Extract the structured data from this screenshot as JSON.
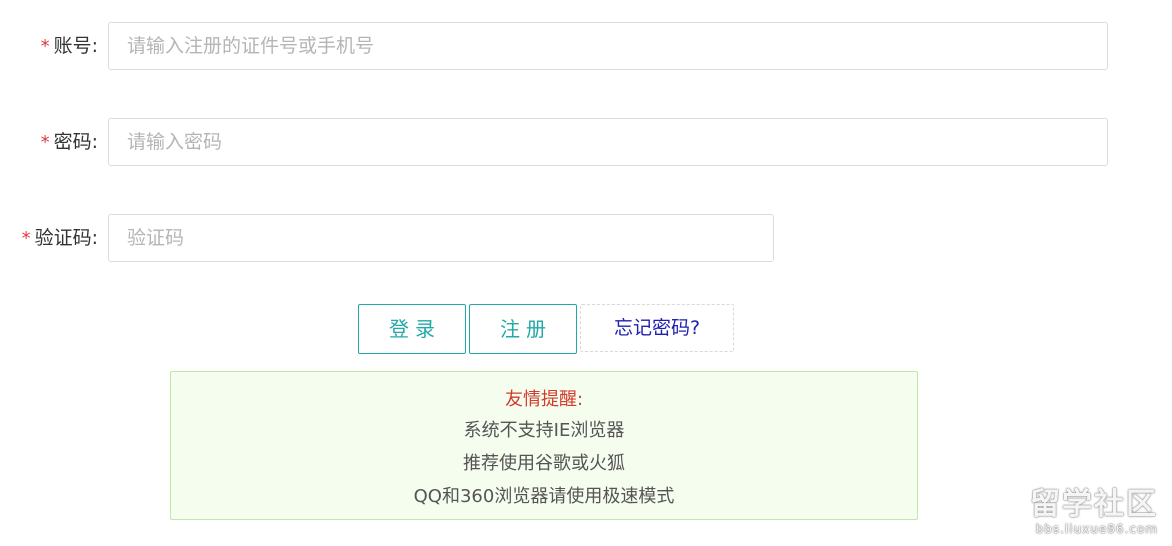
{
  "form": {
    "account": {
      "label": "账号:",
      "required_mark": "*",
      "placeholder": "请输入注册的证件号或手机号",
      "value": ""
    },
    "password": {
      "label": "密码:",
      "required_mark": "*",
      "placeholder": "请输入密码",
      "value": ""
    },
    "captcha": {
      "label": "验证码:",
      "required_mark": "*",
      "placeholder": "验证码",
      "value": ""
    }
  },
  "actions": {
    "login_label": "登录",
    "register_label": "注册",
    "forgot_label": "忘记密码?"
  },
  "notice": {
    "title": "友情提醒:",
    "lines": [
      "系统不支持IE浏览器",
      "推荐使用谷歌或火狐",
      "QQ和360浏览器请使用极速模式"
    ]
  },
  "watermark": {
    "main": "留学社区",
    "sub": "bbs.liuxue86.com"
  },
  "colors": {
    "required": "#e0393e",
    "accent": "#23a8a8",
    "link": "#1f1fb0",
    "notice_bg": "#f5fdef",
    "notice_border": "#c2e7a6",
    "notice_title": "#d33b2c"
  }
}
